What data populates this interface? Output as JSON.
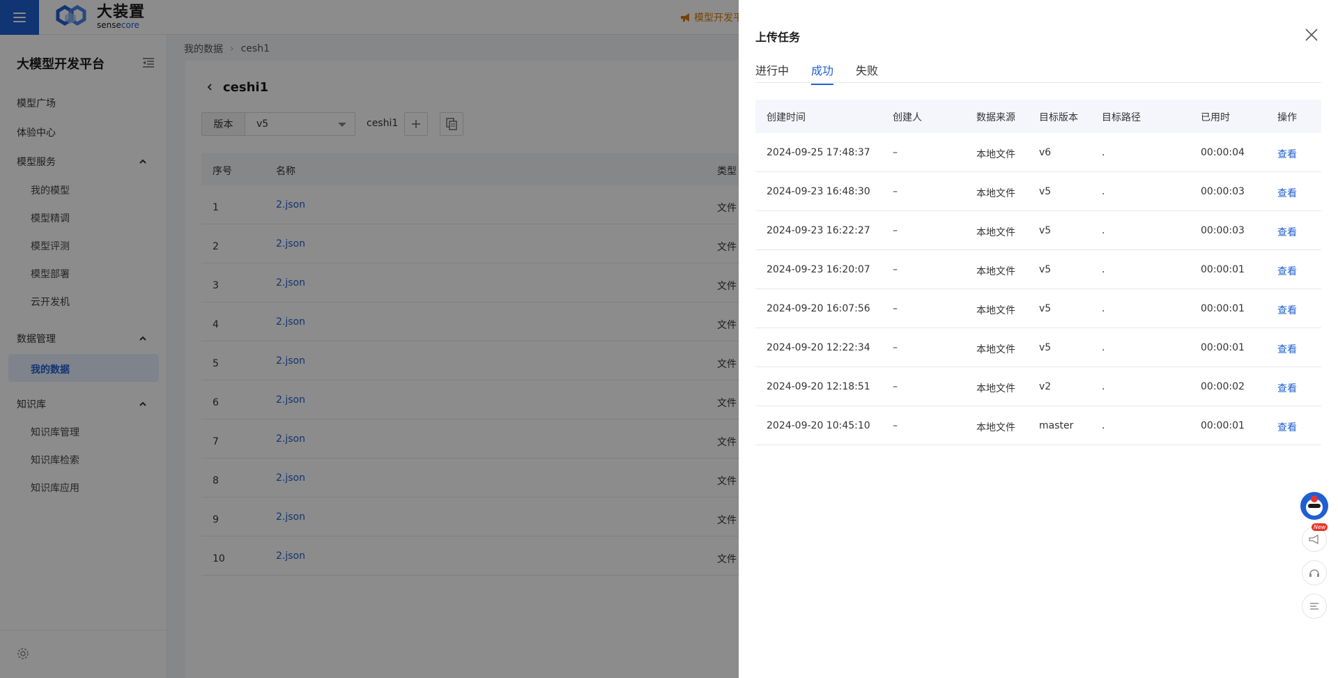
{
  "brand": {
    "name_cn": "大装置",
    "name_en_prefix": "sense",
    "name_en_suffix": "core"
  },
  "announcement": "模型开发平",
  "colors": {
    "accent": "#1f5fd1",
    "warning": "#d97a00",
    "overlay": "rgba(0,0,0,0.45)"
  },
  "sidebar": {
    "title": "大模型开发平台",
    "items": [
      {
        "label": "模型广场"
      },
      {
        "label": "体验中心"
      },
      {
        "label": "模型服务",
        "children": [
          "我的模型",
          "模型精调",
          "模型评测",
          "模型部署",
          "云开发机"
        ]
      },
      {
        "label": "数据管理",
        "children": [
          "我的数据"
        ]
      },
      {
        "label": "知识库",
        "children": [
          "知识库管理",
          "知识库检索",
          "知识库应用"
        ]
      }
    ],
    "active": "我的数据"
  },
  "breadcrumb": [
    "我的数据",
    "cesh1"
  ],
  "page": {
    "title": "ceshi1",
    "version_label": "版本",
    "version_value": "v5",
    "dataset_name": "ceshi1"
  },
  "file_table": {
    "headers": {
      "index": "序号",
      "name": "名称",
      "type": "类型"
    },
    "rows": [
      {
        "index": "1",
        "name": "2.json",
        "type": "文件"
      },
      {
        "index": "2",
        "name": "2.json",
        "type": "文件"
      },
      {
        "index": "3",
        "name": "2.json",
        "type": "文件"
      },
      {
        "index": "4",
        "name": "2.json",
        "type": "文件"
      },
      {
        "index": "5",
        "name": "2.json",
        "type": "文件"
      },
      {
        "index": "6",
        "name": "2.json",
        "type": "文件"
      },
      {
        "index": "7",
        "name": "2.json",
        "type": "文件"
      },
      {
        "index": "8",
        "name": "2.json",
        "type": "文件"
      },
      {
        "index": "9",
        "name": "2.json",
        "type": "文件"
      },
      {
        "index": "10",
        "name": "2.json",
        "type": "文件"
      }
    ]
  },
  "drawer": {
    "title": "上传任务",
    "tabs": [
      "进行中",
      "成功",
      "失败"
    ],
    "active_tab": "成功",
    "headers": {
      "created": "创建时间",
      "creator": "创建人",
      "source": "数据来源",
      "version": "目标版本",
      "path": "目标路径",
      "duration": "已用时",
      "action": "操作"
    },
    "rows": [
      {
        "created": "2024-09-25 17:48:37",
        "creator": "–",
        "source": "本地文件",
        "version": "v6",
        "path": ".",
        "duration": "00:00:04",
        "action": "查看"
      },
      {
        "created": "2024-09-23 16:48:30",
        "creator": "–",
        "source": "本地文件",
        "version": "v5",
        "path": ".",
        "duration": "00:00:03",
        "action": "查看"
      },
      {
        "created": "2024-09-23 16:22:27",
        "creator": "–",
        "source": "本地文件",
        "version": "v5",
        "path": ".",
        "duration": "00:00:03",
        "action": "查看"
      },
      {
        "created": "2024-09-23 16:20:07",
        "creator": "–",
        "source": "本地文件",
        "version": "v5",
        "path": ".",
        "duration": "00:00:01",
        "action": "查看"
      },
      {
        "created": "2024-09-20 16:07:56",
        "creator": "–",
        "source": "本地文件",
        "version": "v5",
        "path": ".",
        "duration": "00:00:01",
        "action": "查看"
      },
      {
        "created": "2024-09-20 12:22:34",
        "creator": "–",
        "source": "本地文件",
        "version": "v5",
        "path": ".",
        "duration": "00:00:01",
        "action": "查看"
      },
      {
        "created": "2024-09-20 12:18:51",
        "creator": "–",
        "source": "本地文件",
        "version": "v2",
        "path": ".",
        "duration": "00:00:02",
        "action": "查看"
      },
      {
        "created": "2024-09-20 10:45:10",
        "creator": "–",
        "source": "本地文件",
        "version": "master",
        "path": ".",
        "duration": "00:00:01",
        "action": "查看"
      }
    ]
  },
  "floating": {
    "new_badge": "New",
    "icons": [
      "assistant-avatar-icon",
      "megaphone-icon",
      "headset-icon",
      "list-menu-icon"
    ]
  }
}
